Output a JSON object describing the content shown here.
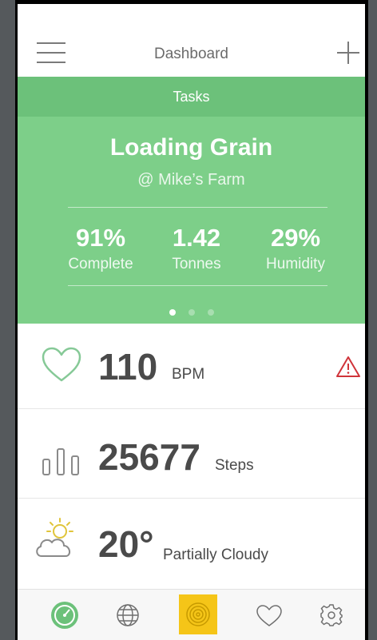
{
  "header": {
    "title": "Dashboard",
    "menu_icon": "hamburger-menu-icon",
    "add_icon": "plus-icon"
  },
  "tasks": {
    "bar_label": "Tasks",
    "title": "Loading Grain",
    "location": "@ Mike’s Farm",
    "stats": [
      {
        "value": "91%",
        "label": "Complete"
      },
      {
        "value": "1.42",
        "label": "Tonnes"
      },
      {
        "value": "29%",
        "label": "Humidity"
      }
    ],
    "pager": {
      "count": 3,
      "active": 0
    }
  },
  "heart": {
    "value": "110",
    "unit": "BPM",
    "icon": "heart-icon",
    "alert_icon": "warning-triangle-icon"
  },
  "steps": {
    "value": "25677",
    "unit": "Steps",
    "icon": "bar-chart-icon"
  },
  "weather": {
    "value": "20°",
    "unit": "Partially Cloudy",
    "icon": "sun-cloud-icon"
  },
  "nav": {
    "items": [
      "speedometer-icon",
      "globe-icon",
      "target-icon",
      "heart-icon",
      "settings-gear-icon"
    ],
    "active": 2
  },
  "colors": {
    "tasks_bar": "#6cc17a",
    "task_card": "#7dcf89",
    "alert": "#d0343a",
    "nav_active": "#f5c518"
  }
}
